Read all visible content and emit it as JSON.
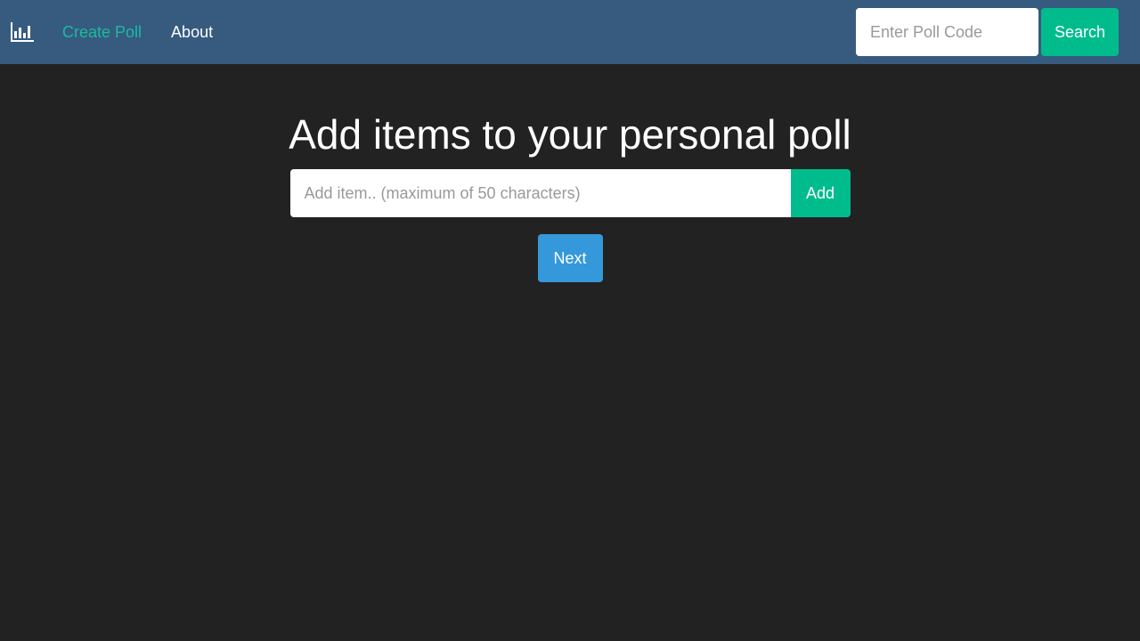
{
  "nav": {
    "create_poll": "Create Poll",
    "about": "About",
    "search_placeholder": "Enter Poll Code",
    "search_label": "Search",
    "active_color": "#1abc9c"
  },
  "main": {
    "title": "Add items to your personal poll",
    "item_placeholder": "Add item.. (maximum of 50 characters)",
    "add_label": "Add",
    "next_label": "Next"
  }
}
